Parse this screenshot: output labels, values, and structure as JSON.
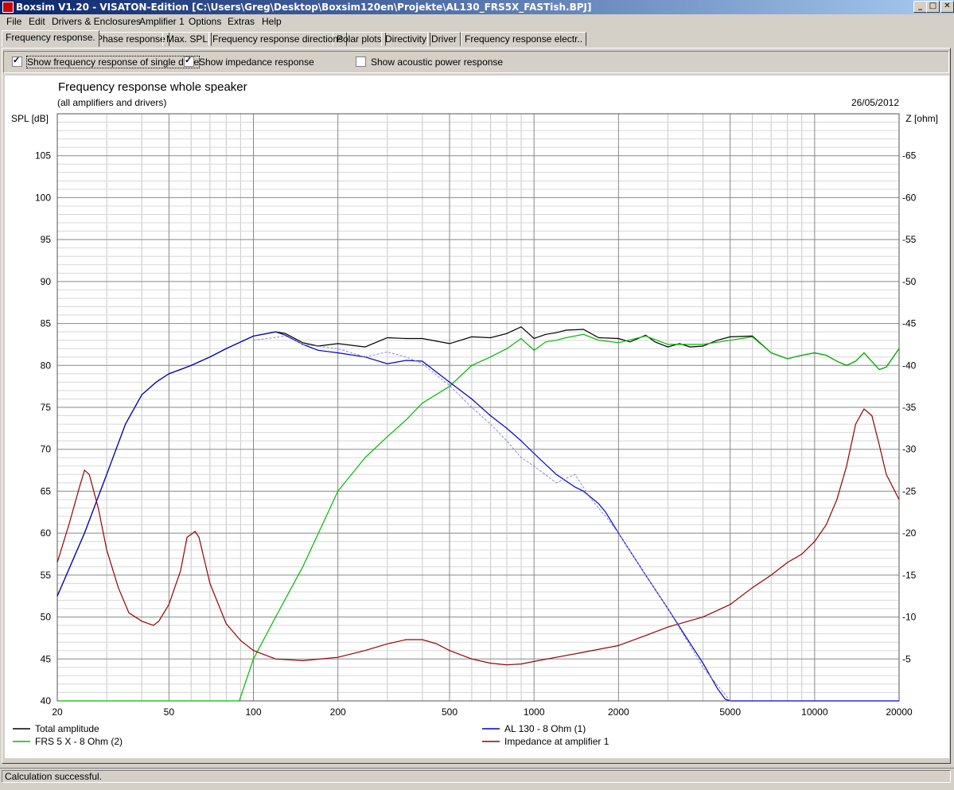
{
  "window": {
    "title": "Boxsim V1.20 - VISATON-Edition [C:\\Users\\Greg\\Desktop\\Boxsim120en\\Projekte\\AL130_FRS5X_FASTish.BPJ]",
    "minimize_glyph": "_",
    "maximize_glyph": "□",
    "close_glyph": "✕"
  },
  "menu": [
    "File",
    "Edit",
    "Drivers & Enclosures",
    "Amplifier 1",
    "Options",
    "Extras",
    "Help"
  ],
  "tabs": [
    "Frequency response.",
    "Phase response",
    "Max. SPL",
    "Frequency response directions",
    "Polar plots",
    "Directivity",
    "Driver",
    "Frequency response electr.."
  ],
  "options": {
    "single_driver": {
      "label": "Show frequency response of single drive",
      "checked": true
    },
    "impedance": {
      "label": "Show impedance response",
      "checked": true
    },
    "acoustic_power": {
      "label": "Show acoustic power response",
      "checked": false
    }
  },
  "status": "Calculation successful.",
  "colors": {
    "total": "#000000",
    "frs5x": "#00bb00",
    "al130": "#0000cc",
    "impedance": "#990000",
    "dashed": "#8888dd"
  },
  "chart_data": {
    "type": "line",
    "title": "Frequency response whole speaker",
    "subtitle": "(all amplifiers and drivers)",
    "date": "26/05/2012",
    "ylabel": "SPL [dB]",
    "y2label": "Z [ohm]",
    "xscale": "log",
    "xlim": [
      20,
      20000
    ],
    "ylim": [
      40,
      110
    ],
    "y2lim": [
      0,
      70
    ],
    "x_ticks": [
      20,
      50,
      100,
      200,
      500,
      1000,
      2000,
      5000,
      10000,
      20000
    ],
    "y_ticks": [
      40,
      45,
      50,
      55,
      60,
      65,
      70,
      75,
      80,
      85,
      90,
      95,
      100,
      105
    ],
    "y2_ticks": [
      5,
      10,
      15,
      20,
      25,
      30,
      35,
      40,
      45,
      50,
      55,
      60,
      65
    ],
    "grid": true,
    "legend": [
      {
        "label": "Total amplitude",
        "key": "total"
      },
      {
        "label": "FRS 5 X - 8 Ohm (2)",
        "key": "frs5x"
      },
      {
        "label": "AL 130 - 8 Ohm (1)",
        "key": "al130"
      },
      {
        "label": "Impedance at amplifier 1",
        "key": "impedance"
      }
    ],
    "series": [
      {
        "key": "total",
        "name": "Total amplitude",
        "axis": "left",
        "x": [
          20,
          25,
          30,
          35,
          40,
          45,
          50,
          55,
          60,
          70,
          80,
          100,
          120,
          130,
          150,
          170,
          200,
          250,
          300,
          350,
          400,
          500,
          600,
          700,
          800,
          900,
          1000,
          1100,
          1200,
          1300,
          1500,
          1700,
          2000,
          2200,
          2500,
          2700,
          3000,
          3300,
          3600,
          4000,
          4500,
          5000,
          6000,
          7000,
          8000,
          9000,
          10000,
          11000,
          12000,
          13000,
          14000,
          15000,
          17000,
          18000,
          20000
        ],
        "y": [
          52.5,
          60,
          67,
          73,
          76.5,
          78,
          79,
          79.5,
          80,
          81,
          82,
          83.5,
          84,
          83.8,
          82.7,
          82.3,
          82.6,
          82.2,
          83.3,
          83.2,
          83.2,
          82.6,
          83.4,
          83.3,
          83.8,
          84.6,
          83.2,
          83.7,
          83.9,
          84.2,
          84.3,
          83.3,
          83.2,
          82.8,
          83.6,
          82.8,
          82.2,
          82.6,
          82.2,
          82.3,
          83,
          83.4,
          83.5,
          81.5,
          80.8,
          81.2,
          81.5,
          81.2,
          80.5,
          80,
          80.5,
          81.5,
          79.5,
          79.8,
          82
        ]
      },
      {
        "key": "frs5x",
        "name": "FRS 5 X - 8 Ohm (2)",
        "axis": "left",
        "x": [
          20,
          89,
          100,
          120,
          150,
          200,
          250,
          300,
          350,
          400,
          500,
          600,
          700,
          800,
          900,
          1000,
          1100,
          1200,
          1300,
          1500,
          1700,
          2000,
          2500,
          3000,
          4000,
          5000,
          6000,
          7000,
          8000,
          9000,
          10000,
          11000,
          12000,
          13000,
          14000,
          15000,
          17000,
          18000,
          20000
        ],
        "y": [
          40,
          40,
          45,
          50,
          56,
          65,
          69,
          71.5,
          73.5,
          75.5,
          77.5,
          80,
          81,
          82,
          83.2,
          81.8,
          82.8,
          83,
          83.3,
          83.7,
          83,
          82.7,
          83.5,
          82.5,
          82.5,
          83,
          83.4,
          81.5,
          80.8,
          81.2,
          81.5,
          81.2,
          80.5,
          80,
          80.5,
          81.5,
          79.5,
          79.8,
          82
        ]
      },
      {
        "key": "al130",
        "name": "AL 130 - 8 Ohm (1)",
        "axis": "left",
        "x": [
          20,
          25,
          30,
          35,
          40,
          45,
          50,
          60,
          70,
          80,
          100,
          120,
          130,
          150,
          170,
          200,
          250,
          300,
          350,
          400,
          500,
          600,
          700,
          800,
          900,
          1000,
          1200,
          1400,
          1500,
          1700,
          1800,
          2000,
          2500,
          3000,
          3500,
          4000,
          4500,
          4800,
          5000,
          20000
        ],
        "y": [
          52.5,
          60,
          67,
          73,
          76.5,
          78,
          79,
          80,
          81,
          82,
          83.5,
          84,
          83.6,
          82.5,
          81.8,
          81.5,
          81,
          80.2,
          80.6,
          80.5,
          78,
          76,
          74,
          72.5,
          71,
          69.5,
          67,
          65.5,
          65,
          63.5,
          62.5,
          60,
          55,
          51,
          47.5,
          44.5,
          41.5,
          40.2,
          40,
          40
        ]
      },
      {
        "key": "impedance",
        "name": "Impedance at amplifier 1",
        "axis": "right",
        "x": [
          20,
          22,
          24,
          25,
          26,
          28,
          30,
          33,
          36,
          40,
          44,
          46,
          50,
          55,
          58,
          62,
          64,
          70,
          80,
          90,
          100,
          120,
          150,
          200,
          250,
          300,
          350,
          400,
          450,
          500,
          600,
          700,
          800,
          900,
          1000,
          1200,
          1500,
          2000,
          2500,
          3000,
          4000,
          5000,
          6000,
          7000,
          8000,
          9000,
          10000,
          11000,
          12000,
          13000,
          14000,
          15000,
          16000,
          17000,
          18000,
          20000
        ],
        "y": [
          16.5,
          21,
          25.5,
          27.5,
          27,
          23,
          18,
          13.5,
          10.5,
          9.5,
          9,
          9.5,
          11.5,
          15.5,
          19.5,
          20.2,
          19.5,
          14,
          9.2,
          7.2,
          6,
          5,
          4.8,
          5.2,
          6,
          6.8,
          7.3,
          7.3,
          6.8,
          6,
          5,
          4.5,
          4.3,
          4.4,
          4.7,
          5.2,
          5.8,
          6.6,
          7.8,
          8.8,
          10,
          11.5,
          13.5,
          15,
          16.5,
          17.5,
          19,
          21,
          24,
          28,
          33,
          34.8,
          34,
          30.5,
          27,
          24
        ]
      },
      {
        "key": "dashed",
        "name": "",
        "axis": "left",
        "x": [
          100,
          130,
          150,
          200,
          250,
          300,
          350,
          400,
          500,
          600,
          700,
          800,
          900,
          1000,
          1200,
          1400,
          1600,
          1800,
          2000,
          2500,
          3000,
          4000,
          5000
        ],
        "y": [
          83,
          83.5,
          82.5,
          82,
          81,
          81.6,
          81,
          80.2,
          77.6,
          75,
          73,
          71,
          69,
          68,
          66,
          67,
          64,
          62,
          60,
          55,
          51,
          44,
          40
        ]
      }
    ]
  }
}
